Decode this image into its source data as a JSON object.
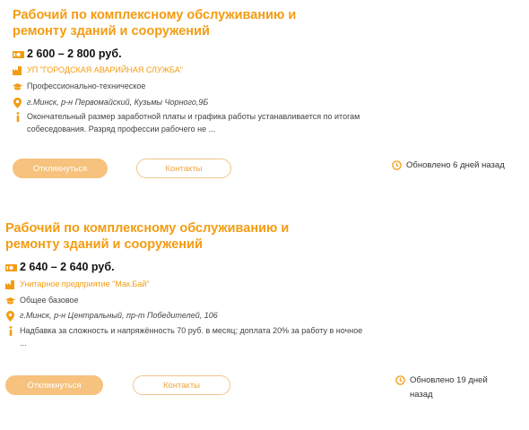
{
  "vacancies": [
    {
      "title": "Рабочий по комплексному обслуживанию и ремонту зданий и сооружений",
      "salary": "2 600 – 2 800 руб.",
      "employer": "УП \"ГОРОДСКАЯ АВАРИЙНАЯ СЛУЖБА\"",
      "education": "Профессионально-техническое",
      "address": "г.Минск, р-н Первомайский, Кузьмы Чорного,9Б",
      "description": "Окончательный размер заработной платы и графика работы устанавливается по итогам собеседования. Разряд профессии рабочего не ...",
      "apply_label": "Откликнуться",
      "contacts_label": "Контакты",
      "updated": "Обновлено 6 дней назад"
    },
    {
      "title": "Рабочий по комплексному обслуживанию и ремонту зданий и сооружений",
      "salary": "2 640 – 2 640 руб.",
      "employer": "Унитарное предприятие \"Мак.Бай\"",
      "education": "Общее базовое",
      "address": "г.Минск, р-н Центральный, пр-т Победителей, 106",
      "description": "Надбавка за сложность и напряжённость 70 руб. в месяц; доплата 20% за работу в ночное ...",
      "apply_label": "Откликнуться",
      "contacts_label": "Контакты",
      "updated": "Обновлено 19 дней назад"
    }
  ],
  "icons": {
    "salary": "money-icon",
    "employer": "factory-icon",
    "education": "graduation-cap-icon",
    "address": "location-pin-icon",
    "description": "info-icon",
    "updated": "clock-icon"
  },
  "colors": {
    "accent": "#f39c12",
    "button_fill": "#f6c27d",
    "button_outline": "#f0c48a"
  }
}
